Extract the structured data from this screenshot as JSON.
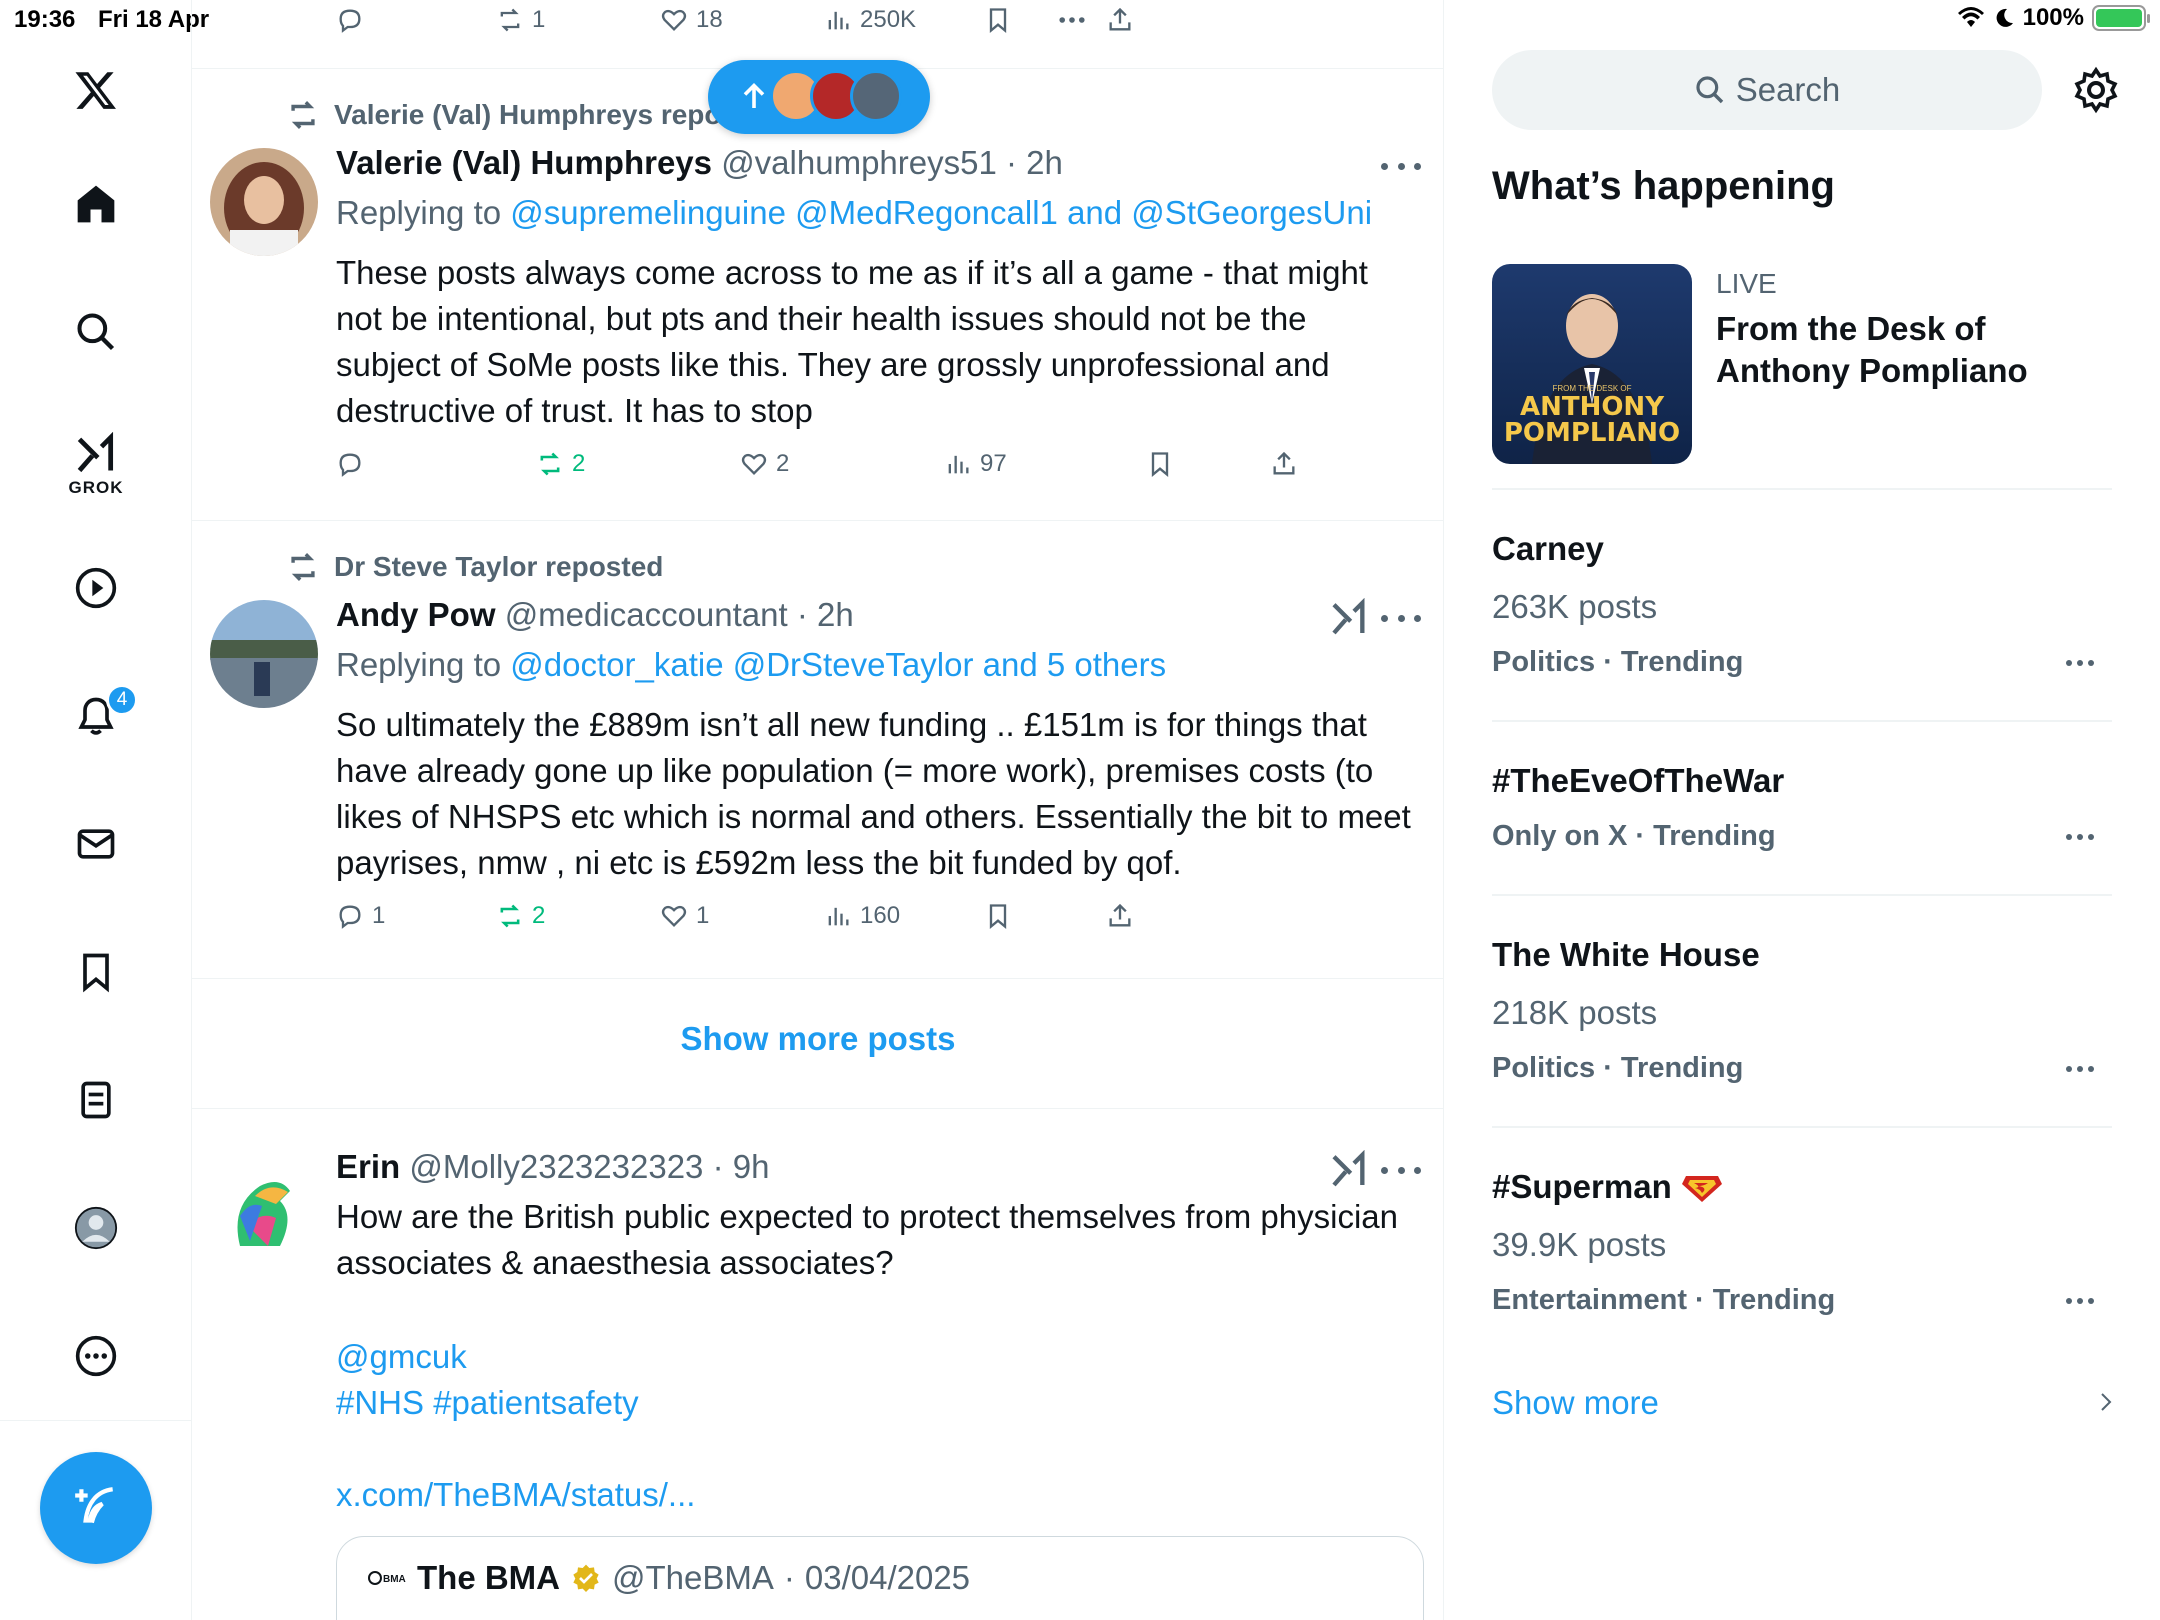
{
  "status_bar": {
    "time": "19:36",
    "date": "Fri 18 Apr",
    "battery": "100%"
  },
  "nav": {
    "grok_label": "GROK",
    "notifications_badge": "4"
  },
  "top_actions": {
    "reposts": "1",
    "likes": "18",
    "views": "250K"
  },
  "new_posts_pill": {
    "label": "new posts"
  },
  "posts": [
    {
      "repost_by": "Valerie (Val) Humphreys reposted",
      "name": "Valerie (Val) Humphreys",
      "handle": "@valhumphreys51",
      "time": "2h",
      "replying_prefix": "Replying to",
      "replying_to": "@supremelinguine @MedRegoncall1 and @StGeorgesUni",
      "text": "These posts always come across to me as if it’s all a game - that might not be intentional, but pts and their health issues should not be the subject of SoMe posts like this. They are grossly unprofessional and destructive of trust. It has to stop",
      "reposts": "2",
      "likes": "2",
      "views": "97"
    },
    {
      "repost_by": "Dr Steve Taylor reposted",
      "name": "Andy Pow",
      "handle": "@medicaccountant",
      "time": "2h",
      "replying_prefix": "Replying to",
      "replying_to": "@doctor_katie @DrSteveTaylor and 5 others",
      "text": "So ultimately the £889m isn’t all new funding .. £151m is for things that have already gone up like population (= more work), premises costs (to likes of NHSPS etc which is normal and others. Essentially the bit to meet payrises, nmw , ni etc is £592m less the bit funded by qof.",
      "replies": "1",
      "reposts": "2",
      "likes": "1",
      "views": "160"
    }
  ],
  "show_more_posts": "Show more posts",
  "erin_post": {
    "name": "Erin",
    "handle": "@Molly2323232323",
    "time": "9h",
    "text": "How are the British public expected to protect themselves from physician associates & anaesthesia associates?",
    "mention": "@gmcuk",
    "hashtags": "#NHS #patientsafety",
    "link": "x.com/TheBMA/status/...",
    "quote": {
      "name": "The BMA",
      "handle": "@TheBMA",
      "date": "03/04/2025"
    }
  },
  "right": {
    "search_placeholder": "Search",
    "whats_happening": "What’s happening",
    "live": {
      "label": "LIVE",
      "title": "From the Desk of Anthony Pompliano",
      "image_small": "FROM THE DESK OF",
      "image_name": "ANTHONY POMPLIANO"
    },
    "trends": [
      {
        "title": "Carney",
        "count": "263K posts",
        "meta": "Politics · Trending"
      },
      {
        "title": "#TheEveOfTheWar",
        "count": "",
        "meta": "Only on X · Trending"
      },
      {
        "title": "The White House",
        "count": "218K posts",
        "meta": "Politics · Trending"
      },
      {
        "title": "#Superman",
        "count": "39.9K posts",
        "meta": "Entertainment · Trending"
      }
    ],
    "show_more": "Show more"
  },
  "colors": {
    "accent": "#1d9bf0",
    "repost_green": "#00ba7c",
    "secondary_text": "#536471"
  }
}
